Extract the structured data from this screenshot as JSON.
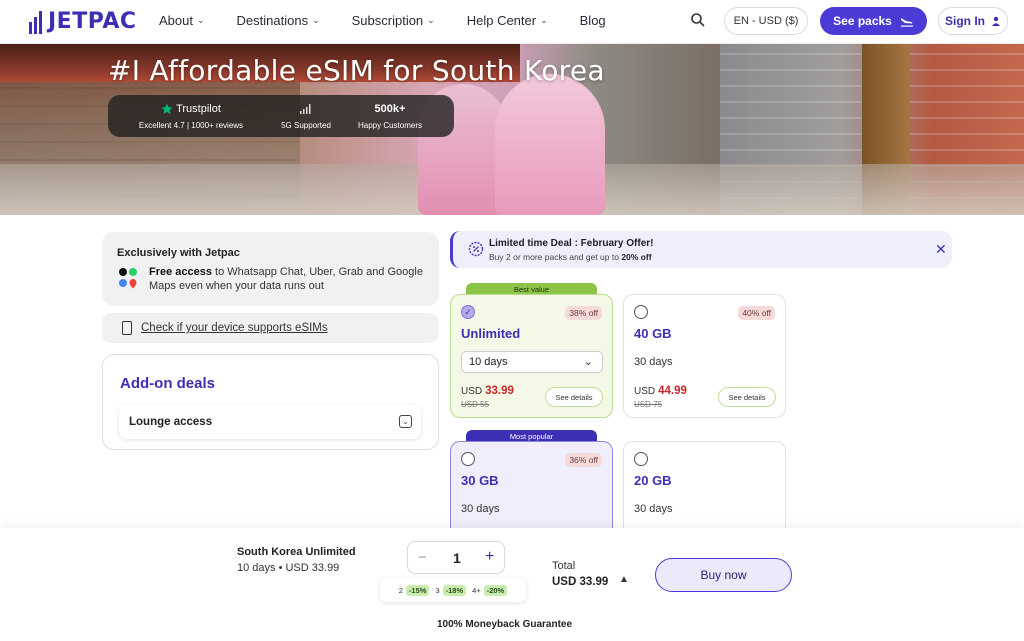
{
  "nav": {
    "logo": "JETPAC",
    "links": [
      {
        "label": "About",
        "dropdown": true
      },
      {
        "label": "Destinations",
        "dropdown": true
      },
      {
        "label": "Subscription",
        "dropdown": true
      },
      {
        "label": "Help Center",
        "dropdown": true
      },
      {
        "label": "Blog",
        "dropdown": false
      }
    ],
    "lang_currency": "EN - USD ($)",
    "see_packs": "See packs",
    "sign_in": "Sign In",
    "accent_color": "#4b3bd6"
  },
  "hero": {
    "title": "#I Affordable eSIM for South Korea",
    "trust": [
      {
        "top": "Trustpilot",
        "bottom": "Excellent 4.7 | 1000+ reviews",
        "icon": "star-icon"
      },
      {
        "top": "",
        "bottom": "5G Supported",
        "icon": "signal-icon"
      },
      {
        "top": "500k+",
        "bottom": "Happy Customers",
        "icon": ""
      }
    ]
  },
  "exclusive": {
    "title": "Exclusively with Jetpac",
    "bold": "Free access",
    "text": " to Whatsapp Chat, Uber, Grab and Google Maps even when your data runs out"
  },
  "check_device": "Check if your device supports eSIMs",
  "addons": {
    "title": "Add-on deals",
    "items": [
      "Lounge access"
    ]
  },
  "deal": {
    "title": "Limited time Deal : February Offer!",
    "text_before": "Buy 2 or more packs and get up to ",
    "highlight": "20% off"
  },
  "packs": [
    {
      "ribbon": "Best value",
      "selected": true,
      "badge": "38% off",
      "data": "Unlimited",
      "duration": "10 days",
      "currency": "USD",
      "price": "33.99",
      "old_price": "USD 55",
      "details": "See details"
    },
    {
      "ribbon": "",
      "selected": false,
      "badge": "40% off",
      "data": "40 GB",
      "duration": "30 days",
      "currency": "USD",
      "price": "44.99",
      "old_price": "USD 75",
      "details": "See details"
    },
    {
      "ribbon": "Most popular",
      "selected": false,
      "badge": "36% off",
      "data": "30 GB",
      "duration": "30 days"
    },
    {
      "ribbon": "",
      "selected": false,
      "badge": "",
      "data": "20 GB",
      "duration": "30 days"
    }
  ],
  "checkout": {
    "selected_name": "South Korea Unlimited",
    "selected_detail": "10 days  •  USD 33.99",
    "quantity": "1",
    "minus": "−",
    "plus": "+",
    "tiers": [
      {
        "qty": "2",
        "discount": "-15%"
      },
      {
        "qty": "3",
        "discount": "-18%"
      },
      {
        "qty": "4+",
        "discount": "-20%"
      }
    ],
    "total_label": "Total",
    "total_value": "USD 33.99",
    "buy": "Buy now",
    "guarantee": "100% Moneyback Guarantee"
  }
}
